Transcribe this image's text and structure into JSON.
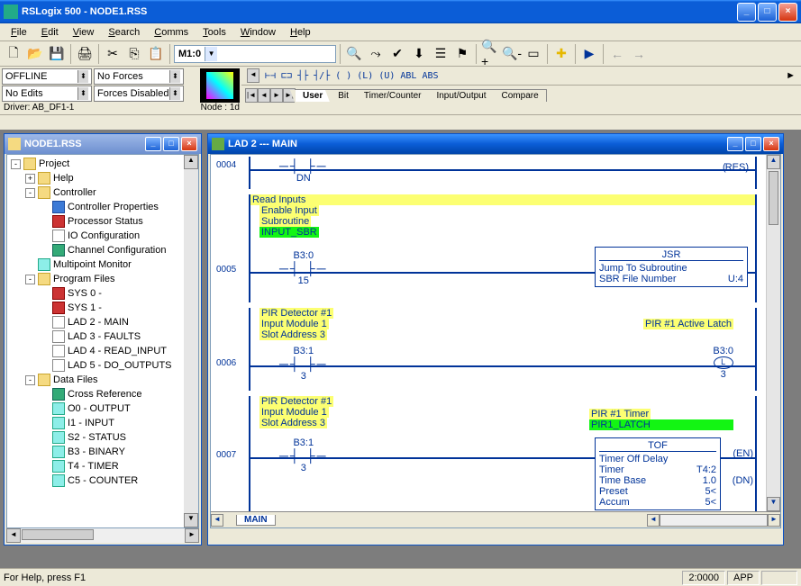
{
  "title": "RSLogix 500 - NODE1.RSS",
  "menu": [
    "File",
    "Edit",
    "View",
    "Search",
    "Comms",
    "Tools",
    "Window",
    "Help"
  ],
  "combo_value": "M1:0",
  "status_panel": {
    "row1": [
      "OFFLINE",
      "No Forces"
    ],
    "row2": [
      "No Edits",
      "Forces Disabled"
    ],
    "driver": "Driver: AB_DF1-1",
    "node": "Node : 1d"
  },
  "instr_tabs": [
    "User",
    "Bit",
    "Timer/Counter",
    "Input/Output",
    "Compare"
  ],
  "tree_win": {
    "title": "NODE1.RSS"
  },
  "tree": {
    "root": "Project",
    "items": [
      {
        "label": "Help",
        "icon": "folder",
        "tw": "+"
      },
      {
        "label": "Controller",
        "icon": "folder",
        "tw": "-",
        "children": [
          {
            "label": "Controller Properties",
            "icon": "blue"
          },
          {
            "label": "Processor Status",
            "icon": "red"
          },
          {
            "label": "IO Configuration",
            "icon": "file"
          },
          {
            "label": "Channel Configuration",
            "icon": "green"
          }
        ]
      },
      {
        "label": "Multipoint Monitor",
        "icon": "cyan"
      },
      {
        "label": "Program Files",
        "icon": "folder",
        "tw": "-",
        "children": [
          {
            "label": "SYS 0 -",
            "icon": "red"
          },
          {
            "label": "SYS 1 -",
            "icon": "red"
          },
          {
            "label": "LAD 2 - MAIN",
            "icon": "file"
          },
          {
            "label": "LAD 3 - FAULTS",
            "icon": "file"
          },
          {
            "label": "LAD 4 - READ_INPUT",
            "icon": "file"
          },
          {
            "label": "LAD 5 - DO_OUTPUTS",
            "icon": "file"
          }
        ]
      },
      {
        "label": "Data Files",
        "icon": "folder",
        "tw": "-",
        "children": [
          {
            "label": "Cross Reference",
            "icon": "green"
          },
          {
            "label": "O0 - OUTPUT",
            "icon": "cyan"
          },
          {
            "label": "I1 - INPUT",
            "icon": "cyan"
          },
          {
            "label": "S2 - STATUS",
            "icon": "cyan"
          },
          {
            "label": "B3 - BINARY",
            "icon": "cyan"
          },
          {
            "label": "T4 - TIMER",
            "icon": "cyan"
          },
          {
            "label": "C5 - COUNTER",
            "icon": "cyan"
          }
        ]
      }
    ]
  },
  "lad_win": {
    "title": "LAD 2 --- MAIN",
    "tab": "MAIN"
  },
  "rungs": {
    "r0004": {
      "num": "0004",
      "dn": "DN",
      "res": "RES"
    },
    "r0005": {
      "num": "0005",
      "header": "Read Inputs",
      "lines": [
        "Enable Input",
        "Subroutine"
      ],
      "green": "INPUT_SBR",
      "contact": {
        "tag": "B3:0",
        "bit": "15"
      },
      "jsr": {
        "title": "JSR",
        "l1": "Jump To Subroutine",
        "l2": "SBR File Number",
        "v2": "U:4"
      }
    },
    "r0006": {
      "num": "0006",
      "lines": [
        "PIR Detector #1",
        "Input Module 1",
        "Slot Address 3"
      ],
      "contact": {
        "tag": "B3:1",
        "bit": "3"
      },
      "coil_label": "PIR #1 Active Latch",
      "coil": {
        "tag": "B3:0",
        "sym": "L",
        "bit": "3"
      }
    },
    "r0007": {
      "num": "0007",
      "lines": [
        "PIR Detector #1",
        "Input Module 1",
        "Slot Address 3"
      ],
      "contact": {
        "tag": "B3:1",
        "bit": "3"
      },
      "timer_label": "PIR #1 Timer",
      "timer_green": "PIR1_LATCH",
      "tof": {
        "title": "TOF",
        "l1": "Timer Off Delay",
        "r1": "Timer",
        "v1": "T4:2",
        "r2": "Time Base",
        "v2": "1.0",
        "r3": "Preset",
        "v3": "5<",
        "r4": "Accum",
        "v4": "5<"
      },
      "en": "EN",
      "dn": "DN"
    }
  },
  "statusbar": {
    "help": "For Help, press F1",
    "pos": "2:0000",
    "mode": "APP"
  }
}
